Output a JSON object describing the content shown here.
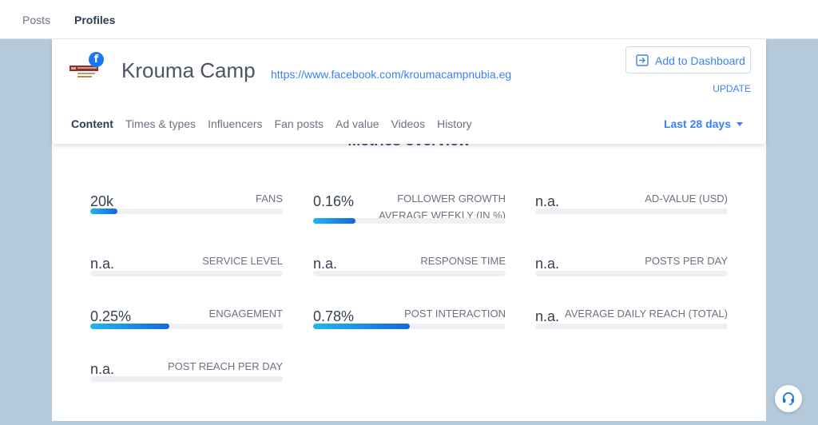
{
  "nav": {
    "tabs": [
      {
        "label": "Posts"
      },
      {
        "label": "Profiles"
      }
    ]
  },
  "profile": {
    "name": "Krouma Camp",
    "url": "https://www.facebook.com/kroumacampnubia.eg",
    "network_badge": "f",
    "add_dashboard_label": "Add to Dashboard",
    "update_label": "UPDATE"
  },
  "subtabs": [
    {
      "label": "Content"
    },
    {
      "label": "Times & types"
    },
    {
      "label": "Influencers"
    },
    {
      "label": "Fan posts"
    },
    {
      "label": "Ad value"
    },
    {
      "label": "Videos"
    },
    {
      "label": "History"
    }
  ],
  "date_range": {
    "label": "Last 28 days"
  },
  "section_title": "Metrics overview",
  "metrics": [
    {
      "value": "20k",
      "label": "FANS",
      "fill": 0.14
    },
    {
      "value": "0.16%",
      "label": "FOLLOWER GROWTH AVERAGE WEEKLY (IN %)",
      "fill": 0.22
    },
    {
      "value": "n.a.",
      "label": "AD-VALUE (USD)",
      "fill": 0
    },
    {
      "value": "n.a.",
      "label": "SERVICE LEVEL",
      "fill": 0
    },
    {
      "value": "n.a.",
      "label": "RESPONSE TIME",
      "fill": 0
    },
    {
      "value": "n.a.",
      "label": "POSTS PER DAY",
      "fill": 0
    },
    {
      "value": "0.25%",
      "label": "ENGAGEMENT",
      "fill": 0.41
    },
    {
      "value": "0.78%",
      "label": "POST INTERACTION",
      "fill": 0.5
    },
    {
      "value": "n.a.",
      "label": "AVERAGE DAILY REACH (TOTAL)",
      "fill": 0
    },
    {
      "value": "n.a.",
      "label": "POST REACH PER DAY",
      "fill": 0
    }
  ],
  "icons": {
    "support": "headset-icon",
    "dashboard": "sign-in-icon",
    "network": "facebook-icon"
  },
  "colors": {
    "accent": "#3b82f6",
    "facebook": "#1877f2",
    "bar_start": "#1fb7f0",
    "bar_end": "#1567e0"
  }
}
